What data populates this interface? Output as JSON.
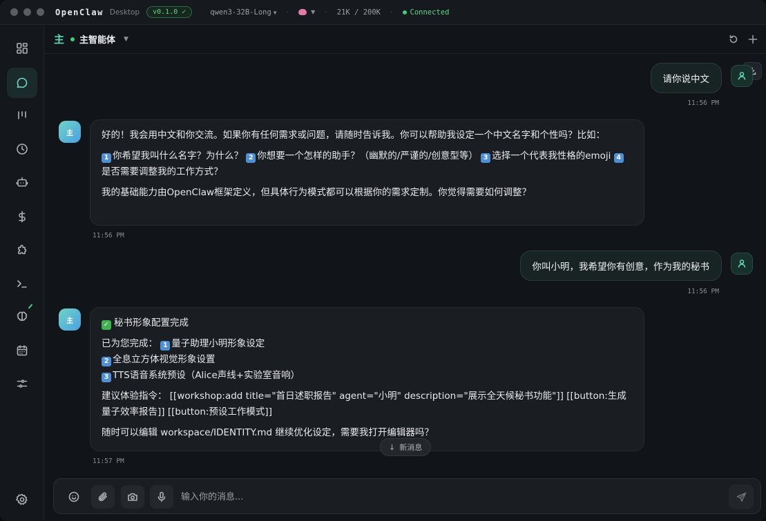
{
  "titlebar": {
    "app_name": "OpenClaw",
    "app_sub": "Desktop",
    "version": "v0.1.0 ✓",
    "model": "qwen3-32B-Long",
    "tokens": "21K / 200K",
    "status": "Connected"
  },
  "header": {
    "agent_glyph": "主",
    "agent_name": "主智能体"
  },
  "sidebar": {
    "items": [
      {
        "icon": "dashboard-icon"
      },
      {
        "icon": "chat-icon",
        "active": true
      },
      {
        "icon": "kanban-icon"
      },
      {
        "icon": "clock-icon"
      },
      {
        "icon": "robot-icon"
      },
      {
        "icon": "dollar-icon"
      },
      {
        "icon": "puzzle-icon"
      },
      {
        "icon": "terminal-icon"
      },
      {
        "icon": "brain-icon"
      },
      {
        "icon": "calendar-icon"
      },
      {
        "icon": "sliders-icon"
      },
      {
        "icon": "settings-icon"
      }
    ]
  },
  "messages": {
    "m1": {
      "text": "请你说中文",
      "time": "11:56 PM"
    },
    "m2": {
      "avatar": "主",
      "p1": "好的！我会用中文和你交流。如果你有任何需求或问题，请随时告诉我。你可以帮助我设定一个中文名字和个性吗？比如：",
      "p2_a": "你希望我叫什么名字？为什么？",
      "p2_b": "你想要一个怎样的助手？（幽默的/严谨的/创意型等）",
      "p2_c": "选择一个代表我性格的emoji",
      "p2_d": "是否需要调整我的工作方式？",
      "p3": "我的基础能力由OpenClaw框架定义，但具体行为模式都可以根据你的需求定制。你觉得需要如何调整？",
      "time": "11:56 PM"
    },
    "m3": {
      "text": "你叫小明，我希望你有创意，作为我的秘书",
      "time": "11:56 PM"
    },
    "m4": {
      "avatar": "主",
      "title": "秘书形象配置完成",
      "intro": "已为您完成：",
      "item1": "量子助理小明形象设定",
      "item2": "全息立方体视觉形象设置",
      "item3": "TTS语音系统预设（Alice声线+实验室音响）",
      "suggest": "建议体验指令：  [[workshop:add title=\"首日述职报告\" agent=\"小明\" description=\"展示全天候秘书功能\"]] [[button:生成量子效率报告]] [[button:预设工作模式]]",
      "closing": "随时可以编辑 workspace/IDENTITY.md 继续优化设定，需要我打开编辑器吗？",
      "time": "11:57 PM"
    }
  },
  "emoji_numbers": [
    "1",
    "2",
    "3",
    "4"
  ],
  "new_messages_label": "新消息",
  "composer": {
    "placeholder": "输入你的消息..."
  },
  "colors": {
    "accent": "#5fd8b8",
    "connected": "#3fcf7a",
    "background": "#111418"
  }
}
